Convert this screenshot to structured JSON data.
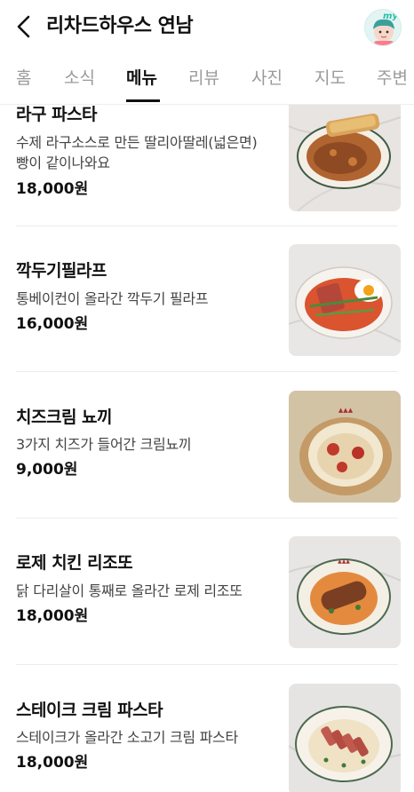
{
  "header": {
    "title": "리차드하우스 연남",
    "avatar_badge": "my"
  },
  "tabs": [
    "홈",
    "소식",
    "메뉴",
    "리뷰",
    "사진",
    "지도",
    "주변"
  ],
  "active_tab": "메뉴",
  "menu": [
    {
      "name": "라구 파스타",
      "desc_line1": "수제 라구소스로 만든 딸리아딸레(넓은면)",
      "desc_line2": "빵이 같이나와요",
      "price": "18,000원"
    },
    {
      "name": "깍두기필라프",
      "desc_line1": "통베이컨이 올라간 깍두기 필라프",
      "desc_line2": "",
      "price": "16,000원"
    },
    {
      "name": "치즈크림 뇨끼",
      "desc_line1": "3가지 치즈가 들어간 크림뇨끼",
      "desc_line2": "",
      "price": "9,000원"
    },
    {
      "name": "로제 치킨 리조또",
      "desc_line1": "닭 다리살이 통째로 올라간 로제 리조또",
      "desc_line2": "",
      "price": "18,000원"
    },
    {
      "name": "스테이크 크림 파스타",
      "desc_line1": "스테이크가 올라간 소고기 크림 파스타",
      "desc_line2": "",
      "price": "18,000원"
    }
  ]
}
